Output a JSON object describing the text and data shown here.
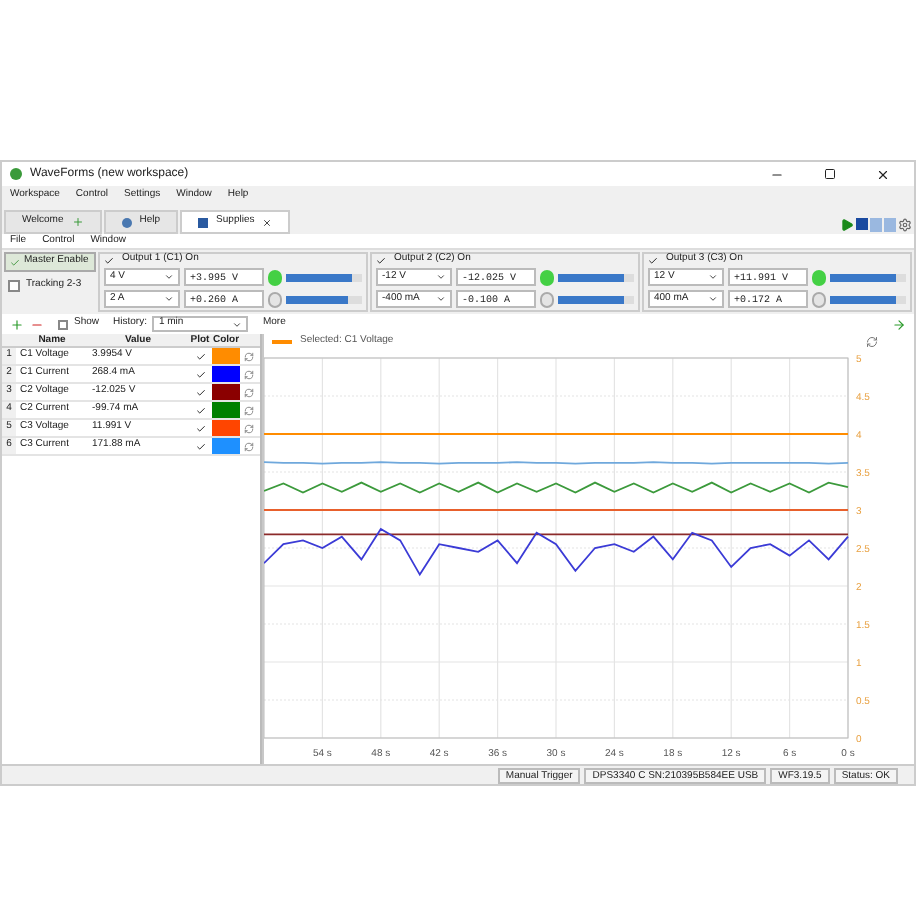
{
  "window": {
    "title": "WaveForms (new workspace)"
  },
  "menu": [
    "Workspace",
    "Control",
    "Settings",
    "Window",
    "Help"
  ],
  "tabs": [
    {
      "label": "Welcome",
      "selected": false,
      "kind": "welcome"
    },
    {
      "label": "Help",
      "selected": false,
      "kind": "help"
    },
    {
      "label": "Supplies",
      "selected": true,
      "kind": "supplies"
    }
  ],
  "submenu": [
    "File",
    "Control",
    "Window"
  ],
  "master_enable": {
    "label": "Master Enable",
    "on": true
  },
  "tracking": {
    "label": "Tracking 2-3",
    "checked": false
  },
  "outputs": [
    {
      "title": "Output 1 (C1) On",
      "checked": true,
      "voltage_set": "4 V",
      "voltage_reading": "+3.995 V",
      "voltage_led": true,
      "voltage_slider": {
        "level": 0.86
      },
      "current_set": "2 A",
      "current_reading": "+0.260 A",
      "current_led": false,
      "current_slider": {
        "level": 0.82
      }
    },
    {
      "title": "Output 2 (C2) On",
      "checked": true,
      "voltage_set": "-12 V",
      "voltage_reading": "-12.025 V",
      "voltage_led": true,
      "voltage_slider": {
        "level": 0.86
      },
      "current_set": "-400 mA",
      "current_reading": "-0.100 A",
      "current_led": false,
      "current_slider": {
        "level": 0.86
      }
    },
    {
      "title": "Output 3 (C3) On",
      "checked": true,
      "voltage_set": "12 V",
      "voltage_reading": "+11.991 V",
      "voltage_led": true,
      "voltage_slider": {
        "level": 0.86
      },
      "current_set": "400 mA",
      "current_reading": "+0.172 A",
      "current_led": false,
      "current_slider": {
        "level": 0.86
      }
    }
  ],
  "toolbar": {
    "show_checked": false,
    "show": "Show",
    "history_label": "History:",
    "history_value": "1 min",
    "more": "More"
  },
  "table": {
    "columns": [
      "Name",
      "Value",
      "Plot",
      "Color"
    ],
    "rows": [
      {
        "index": "1",
        "name": "C1 Voltage",
        "value": "3.9954 V",
        "plot": true,
        "color": "#ff8c00"
      },
      {
        "index": "2",
        "name": "C1 Current",
        "value": "268.4 mA",
        "plot": true,
        "color": "#0000ff"
      },
      {
        "index": "3",
        "name": "C2 Voltage",
        "value": "-12.025 V",
        "plot": true,
        "color": "#8b0000"
      },
      {
        "index": "4",
        "name": "C2 Current",
        "value": "-99.74 mA",
        "plot": true,
        "color": "#008000"
      },
      {
        "index": "5",
        "name": "C3 Voltage",
        "value": "11.991 V",
        "plot": true,
        "color": "#ff4500"
      },
      {
        "index": "6",
        "name": "C3 Current",
        "value": "171.88 mA",
        "plot": true,
        "color": "#1e90ff"
      }
    ]
  },
  "chart": {
    "legend": "Selected: C1 Voltage",
    "chart_data": {
      "type": "line",
      "grid": true,
      "xlim": [
        60,
        0
      ],
      "ylim": [
        0,
        5
      ],
      "xticks": [
        {
          "value": 54,
          "label": "54 s"
        },
        {
          "value": 48,
          "label": "48 s"
        },
        {
          "value": 42,
          "label": "42 s"
        },
        {
          "value": 36,
          "label": "36 s"
        },
        {
          "value": 30,
          "label": "30 s"
        },
        {
          "value": 24,
          "label": "24 s"
        },
        {
          "value": 18,
          "label": "18 s"
        },
        {
          "value": 12,
          "label": "12 s"
        },
        {
          "value": 6,
          "label": "6 s"
        },
        {
          "value": 0,
          "label": "0 s"
        }
      ],
      "yticks": [
        0,
        0.5,
        1,
        1.5,
        2,
        2.5,
        3,
        3.5,
        4,
        4.5,
        5
      ],
      "x": [
        60,
        58,
        56,
        54,
        52,
        50,
        48,
        46,
        44,
        42,
        40,
        38,
        36,
        34,
        32,
        30,
        28,
        26,
        24,
        22,
        20,
        18,
        16,
        14,
        12,
        10,
        8,
        6,
        4,
        2,
        0
      ],
      "series": [
        {
          "color": "#ff8c00",
          "values": [
            4,
            4,
            4,
            4,
            4,
            4,
            4,
            4,
            4,
            4,
            4,
            4,
            4,
            4,
            4,
            4,
            4,
            4,
            4,
            4,
            4,
            4,
            4,
            4,
            4,
            4,
            4,
            4,
            4,
            4,
            4
          ]
        },
        {
          "color": "#6fa8dc",
          "values": [
            3.63,
            3.62,
            3.62,
            3.61,
            3.62,
            3.62,
            3.63,
            3.62,
            3.62,
            3.61,
            3.62,
            3.62,
            3.62,
            3.63,
            3.62,
            3.62,
            3.61,
            3.62,
            3.62,
            3.62,
            3.63,
            3.62,
            3.62,
            3.61,
            3.62,
            3.62,
            3.62,
            3.62,
            3.62,
            3.61,
            3.62
          ]
        },
        {
          "color": "#3c9a3c",
          "values": [
            3.25,
            3.35,
            3.23,
            3.35,
            3.24,
            3.36,
            3.24,
            3.35,
            3.23,
            3.35,
            3.24,
            3.36,
            3.23,
            3.35,
            3.24,
            3.35,
            3.23,
            3.36,
            3.24,
            3.35,
            3.23,
            3.35,
            3.24,
            3.36,
            3.23,
            3.35,
            3.24,
            3.35,
            3.23,
            3.36,
            3.3
          ]
        },
        {
          "color": "#e8602c",
          "values": [
            3,
            3,
            3,
            3,
            3,
            3,
            3,
            3,
            3,
            3,
            3,
            3,
            3,
            3,
            3,
            3,
            3,
            3,
            3,
            3,
            3,
            3,
            3,
            3,
            3,
            3,
            3,
            3,
            3,
            3,
            3
          ]
        },
        {
          "color": "#8b2a2a",
          "values": [
            2.68,
            2.68,
            2.68,
            2.68,
            2.68,
            2.68,
            2.68,
            2.68,
            2.68,
            2.68,
            2.68,
            2.68,
            2.68,
            2.68,
            2.68,
            2.68,
            2.68,
            2.68,
            2.68,
            2.68,
            2.68,
            2.68,
            2.68,
            2.68,
            2.68,
            2.68,
            2.68,
            2.68,
            2.68,
            2.68,
            2.68
          ]
        },
        {
          "color": "#3b3bd6",
          "values": [
            2.3,
            2.55,
            2.6,
            2.5,
            2.65,
            2.35,
            2.75,
            2.6,
            2.15,
            2.55,
            2.5,
            2.45,
            2.6,
            2.3,
            2.7,
            2.55,
            2.2,
            2.5,
            2.55,
            2.45,
            2.65,
            2.35,
            2.7,
            2.6,
            2.25,
            2.5,
            2.55,
            2.4,
            2.6,
            2.35,
            2.65
          ]
        }
      ]
    }
  },
  "status_bar": [
    "Manual Trigger",
    "DPS3340 C SN:210395B584EE USB",
    "WF3.19.5",
    "Status: OK"
  ]
}
